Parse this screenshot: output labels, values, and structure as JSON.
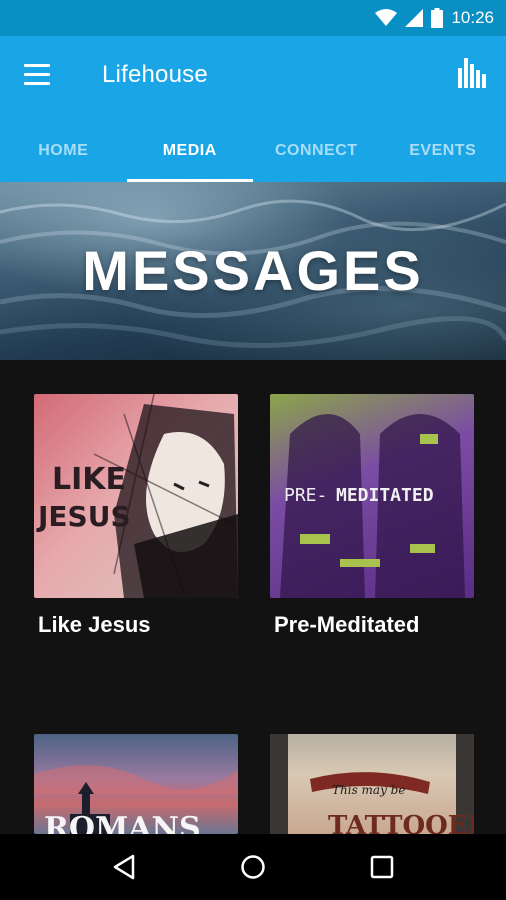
{
  "status_bar": {
    "time": "10:26",
    "icons": [
      "wifi-icon",
      "signal-icon",
      "battery-icon"
    ]
  },
  "app_bar": {
    "title": "Lifehouse",
    "menu_icon": "menu-icon",
    "action_icon": "bar-chart-icon"
  },
  "tabs": [
    {
      "label": "HOME",
      "active": false
    },
    {
      "label": "MEDIA",
      "active": true
    },
    {
      "label": "CONNECT",
      "active": false
    },
    {
      "label": "EVENTS",
      "active": false
    }
  ],
  "hero": {
    "title": "MESSAGES"
  },
  "series": [
    {
      "title": "Like Jesus",
      "artwork_text": [
        "LIKE",
        "JESUS"
      ]
    },
    {
      "title": "Pre-Meditated",
      "artwork_text": [
        "PRE-",
        "MEDITATED"
      ]
    },
    {
      "title": "",
      "artwork_text": [
        "ROMANS"
      ]
    },
    {
      "title": "",
      "artwork_text": [
        "This may be",
        "TATTOOED"
      ]
    }
  ],
  "nav_bar": {
    "icons": [
      "back-icon",
      "home-icon",
      "recents-icon"
    ]
  },
  "colors": {
    "status_bar": "#0a8fc4",
    "app_bar": "#1aa6e6",
    "background": "#121212",
    "nav_bar": "#000000"
  }
}
